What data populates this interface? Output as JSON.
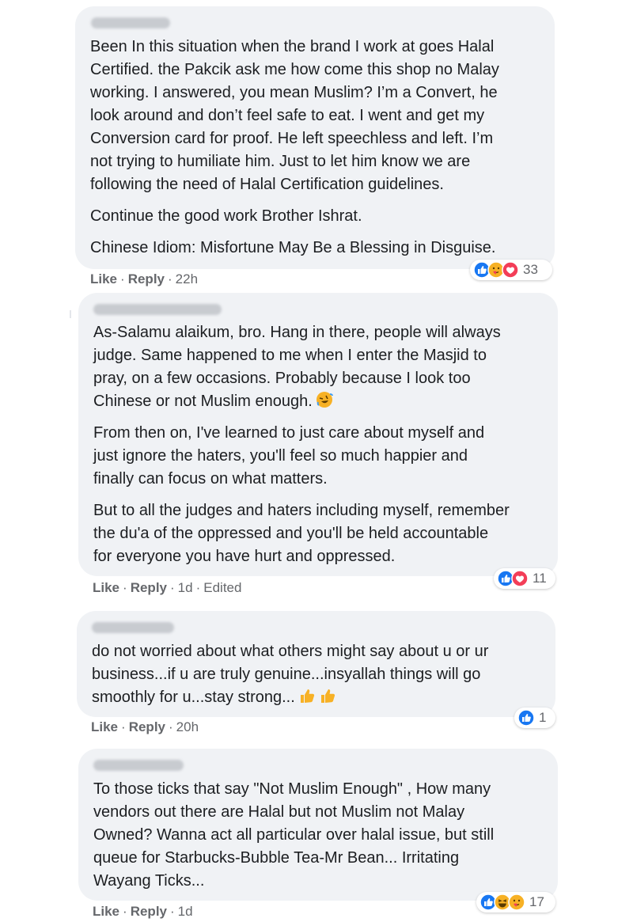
{
  "comments": [
    {
      "paragraphs": [
        [
          "Been In this situation when the brand I work at goes Halal",
          "Certified. the Pakcik ask me how come this shop no Malay",
          "working. I answered, you mean Muslim? I’m a Convert, he",
          "look around and don’t feel safe to eat. I went and get my",
          "Conversion card for proof. He left speechless and left. I’m",
          "not trying to humiliate him. Just to let him know we are",
          "following the need of Halal Certification guidelines."
        ],
        [
          "Continue the good work Brother Ishrat."
        ],
        [
          "Chinese Idiom: Misfortune May Be a Blessing in Disguise."
        ]
      ],
      "like": "Like",
      "reply": "Reply",
      "time": "22h",
      "edited": "",
      "reactions": [
        "like-icon",
        "care-icon",
        "love-icon"
      ],
      "reaction_count": "33"
    },
    {
      "paragraphs": [
        [
          "As-Salamu alaikum, bro. Hang in there, people will always",
          "judge. Same happened to me when I enter the Masjid to",
          "pray, on a few occasions. Probably because I look too",
          "Chinese or not Muslim enough."
        ],
        [
          "From then on, I've learned to just care about myself and",
          "just ignore the haters, you'll feel so much happier and",
          "finally can focus on what matters."
        ],
        [
          "But to all the judges and haters including myself, remember",
          "the du'a of the oppressed and you'll be held accountable",
          "for everyone you have hurt and oppressed."
        ]
      ],
      "inline_emoji": "rolling-laughing-emoji-icon",
      "like": "Like",
      "reply": "Reply",
      "time": "1d",
      "edited": "Edited",
      "reactions": [
        "like-icon",
        "love-icon"
      ],
      "reaction_count": "11"
    },
    {
      "paragraphs": [
        [
          "do not worried about what others might say about u or ur",
          "business...if u are truly genuine...insyallah things will go",
          "smoothly for u...stay strong..."
        ]
      ],
      "inline_emoji": "thumbs-up-emoji-icon",
      "like": "Like",
      "reply": "Reply",
      "time": "20h",
      "edited": "",
      "reactions": [
        "like-icon"
      ],
      "reaction_count": "1"
    },
    {
      "paragraphs": [
        [
          "To those ticks that say \"Not Muslim Enough\" , How many",
          "vendors out there are Halal but not Muslim not Malay",
          "Owned? Wanna act all particular over halal issue, but still",
          "queue for Starbucks-Bubble Tea-Mr Bean... Irritating",
          "Wayang Ticks..."
        ]
      ],
      "like": "Like",
      "reply": "Reply",
      "time": "1d",
      "edited": "",
      "reactions": [
        "like-icon",
        "haha-icon",
        "care-icon"
      ],
      "reaction_count": "17"
    }
  ],
  "colors": {
    "bubble": "#f0f2f5",
    "like_blue": "#1877f2",
    "love_red": "#f33e58",
    "emoji_yellow": "#f7b125",
    "meta_gray": "#65676b"
  }
}
